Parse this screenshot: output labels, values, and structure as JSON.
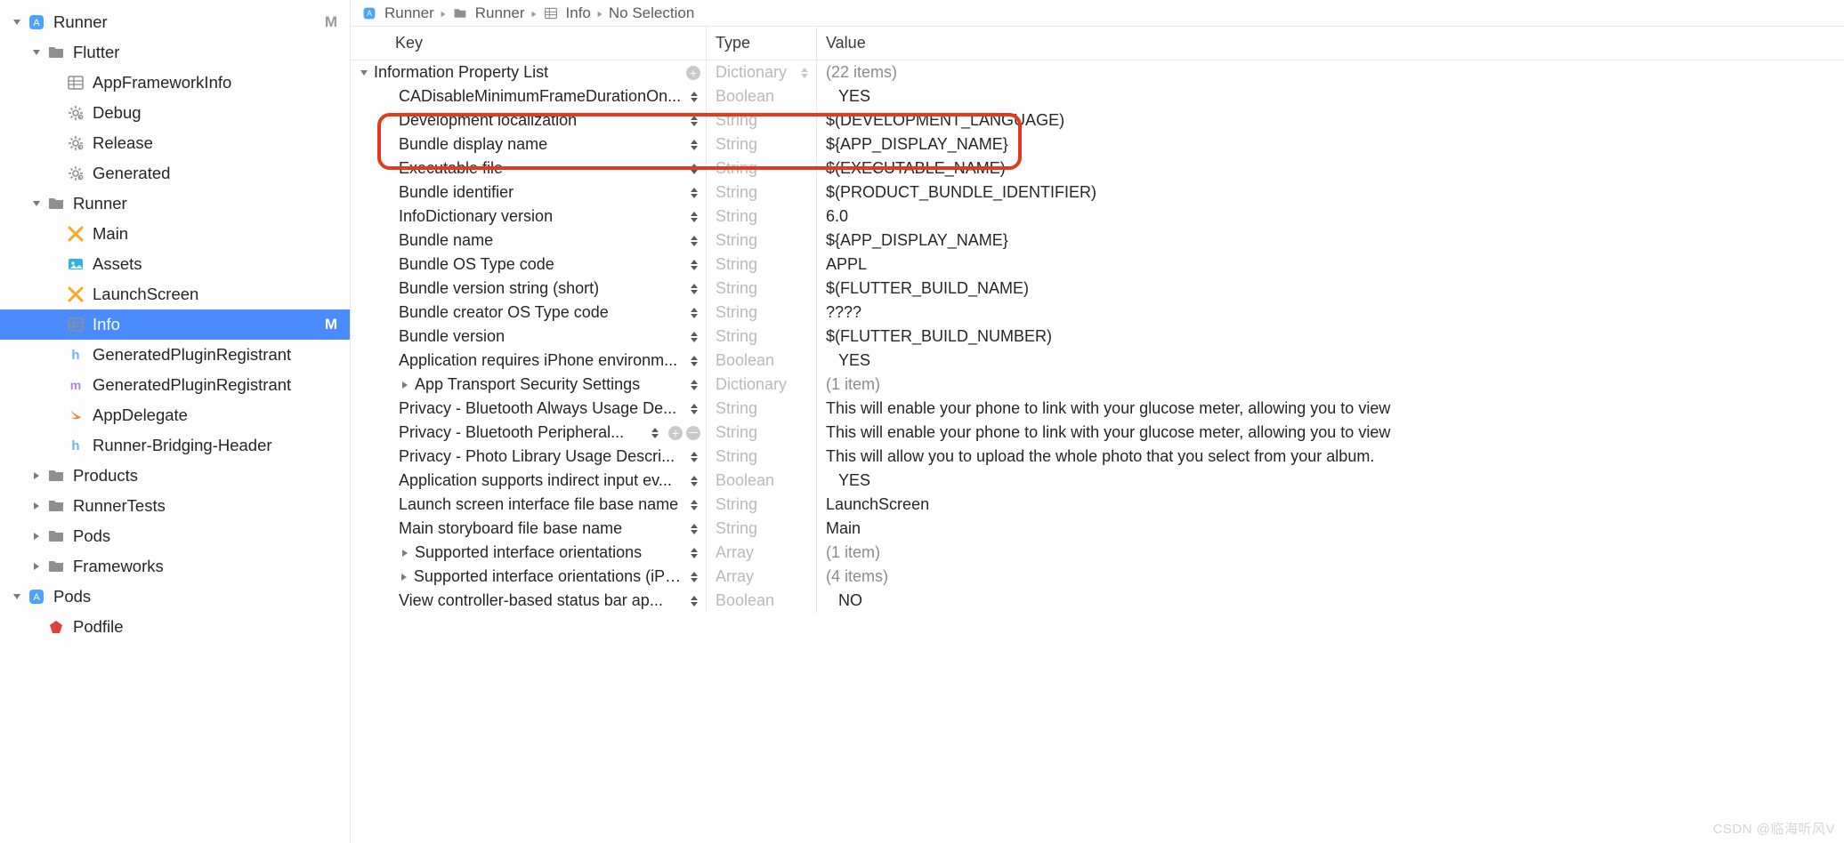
{
  "breadcrumb": {
    "items": [
      {
        "label": "Runner",
        "icon": "app-icon"
      },
      {
        "label": "Runner",
        "icon": "folder-icon"
      },
      {
        "label": "Info",
        "icon": "grid-icon"
      },
      {
        "label": "No Selection",
        "icon": ""
      }
    ]
  },
  "sidebar": {
    "items": [
      {
        "indent": 0,
        "icon": "app-icon",
        "label": "Runner",
        "disclosure": "down",
        "badge": "M"
      },
      {
        "indent": 1,
        "icon": "folder-icon",
        "label": "Flutter",
        "disclosure": "down"
      },
      {
        "indent": 2,
        "icon": "grid-icon",
        "label": "AppFrameworkInfo",
        "disclosure": ""
      },
      {
        "indent": 2,
        "icon": "gear-icon",
        "label": "Debug",
        "disclosure": ""
      },
      {
        "indent": 2,
        "icon": "gear-icon",
        "label": "Release",
        "disclosure": ""
      },
      {
        "indent": 2,
        "icon": "gear-icon",
        "label": "Generated",
        "disclosure": ""
      },
      {
        "indent": 1,
        "icon": "folder-icon",
        "label": "Runner",
        "disclosure": "down"
      },
      {
        "indent": 2,
        "icon": "storyboard-icon",
        "label": "Main",
        "disclosure": ""
      },
      {
        "indent": 2,
        "icon": "assets-icon",
        "label": "Assets",
        "disclosure": ""
      },
      {
        "indent": 2,
        "icon": "storyboard-icon",
        "label": "LaunchScreen",
        "disclosure": ""
      },
      {
        "indent": 2,
        "icon": "grid-icon",
        "label": "Info",
        "disclosure": "",
        "badge": "M",
        "selected": true
      },
      {
        "indent": 2,
        "icon": "h-icon",
        "label": "GeneratedPluginRegistrant",
        "disclosure": ""
      },
      {
        "indent": 2,
        "icon": "m-icon",
        "label": "GeneratedPluginRegistrant",
        "disclosure": ""
      },
      {
        "indent": 2,
        "icon": "swift-icon",
        "label": "AppDelegate",
        "disclosure": ""
      },
      {
        "indent": 2,
        "icon": "h-icon",
        "label": "Runner-Bridging-Header",
        "disclosure": ""
      },
      {
        "indent": 1,
        "icon": "folder-icon",
        "label": "Products",
        "disclosure": "right"
      },
      {
        "indent": 1,
        "icon": "folder-icon",
        "label": "RunnerTests",
        "disclosure": "right"
      },
      {
        "indent": 1,
        "icon": "folder-icon",
        "label": "Pods",
        "disclosure": "right"
      },
      {
        "indent": 1,
        "icon": "folder-icon",
        "label": "Frameworks",
        "disclosure": "right"
      },
      {
        "indent": 0,
        "icon": "app-icon",
        "label": "Pods",
        "disclosure": "down"
      },
      {
        "indent": 1,
        "icon": "ruby-icon",
        "label": "Podfile",
        "disclosure": ""
      }
    ]
  },
  "plist": {
    "headers": {
      "key": "Key",
      "type": "Type",
      "value": "Value"
    },
    "root": {
      "key": "Information Property List",
      "type": "Dictionary",
      "value": "(22 items)"
    },
    "rows": [
      {
        "indent": 1,
        "key": "CADisableMinimumFrameDurationOn...",
        "type": "Boolean",
        "value": "YES",
        "valIndent": 1
      },
      {
        "indent": 1,
        "key": "Development localization",
        "type": "String",
        "value": "$(DEVELOPMENT_LANGUAGE)"
      },
      {
        "indent": 1,
        "key": "Bundle display name",
        "type": "String",
        "value": "${APP_DISPLAY_NAME}"
      },
      {
        "indent": 1,
        "key": "Executable file",
        "type": "String",
        "value": "$(EXECUTABLE_NAME)"
      },
      {
        "indent": 1,
        "key": "Bundle identifier",
        "type": "String",
        "value": "$(PRODUCT_BUNDLE_IDENTIFIER)"
      },
      {
        "indent": 1,
        "key": "InfoDictionary version",
        "type": "String",
        "value": "6.0"
      },
      {
        "indent": 1,
        "key": "Bundle name",
        "type": "String",
        "value": "${APP_DISPLAY_NAME}"
      },
      {
        "indent": 1,
        "key": "Bundle OS Type code",
        "type": "String",
        "value": "APPL"
      },
      {
        "indent": 1,
        "key": "Bundle version string (short)",
        "type": "String",
        "value": "$(FLUTTER_BUILD_NAME)"
      },
      {
        "indent": 1,
        "key": "Bundle creator OS Type code",
        "type": "String",
        "value": "????"
      },
      {
        "indent": 1,
        "key": "Bundle version",
        "type": "String",
        "value": "$(FLUTTER_BUILD_NUMBER)"
      },
      {
        "indent": 1,
        "key": "Application requires iPhone environm...",
        "type": "Boolean",
        "value": "YES",
        "valIndent": 1
      },
      {
        "indent": 1,
        "key": "App Transport Security Settings",
        "type": "Dictionary",
        "value": "(1 item)",
        "disclosure": "right",
        "muted": true
      },
      {
        "indent": 1,
        "key": "Privacy - Bluetooth Always Usage De...",
        "type": "String",
        "value": "This will enable your phone to link with your glucose meter, allowing you to view"
      },
      {
        "indent": 1,
        "key": "Privacy - Bluetooth Peripheral...",
        "type": "String",
        "value": "This will enable your phone to link with your glucose meter, allowing you to view",
        "showPM": true
      },
      {
        "indent": 1,
        "key": "Privacy - Photo Library Usage Descri...",
        "type": "String",
        "value": "This will allow you to upload the whole photo that you select from your album."
      },
      {
        "indent": 1,
        "key": "Application supports indirect input ev...",
        "type": "Boolean",
        "value": "YES",
        "valIndent": 1
      },
      {
        "indent": 1,
        "key": "Launch screen interface file base name",
        "type": "String",
        "value": "LaunchScreen"
      },
      {
        "indent": 1,
        "key": "Main storyboard file base name",
        "type": "String",
        "value": "Main"
      },
      {
        "indent": 1,
        "key": "Supported interface orientations",
        "type": "Array",
        "value": "(1 item)",
        "disclosure": "right",
        "muted": true
      },
      {
        "indent": 1,
        "key": "Supported interface orientations (iPad)",
        "type": "Array",
        "value": "(4 items)",
        "disclosure": "right",
        "muted": true
      },
      {
        "indent": 1,
        "key": "View controller-based status bar ap...",
        "type": "Boolean",
        "value": "NO",
        "valIndent": 1
      }
    ]
  },
  "watermark": "CSDN @临海听风V"
}
